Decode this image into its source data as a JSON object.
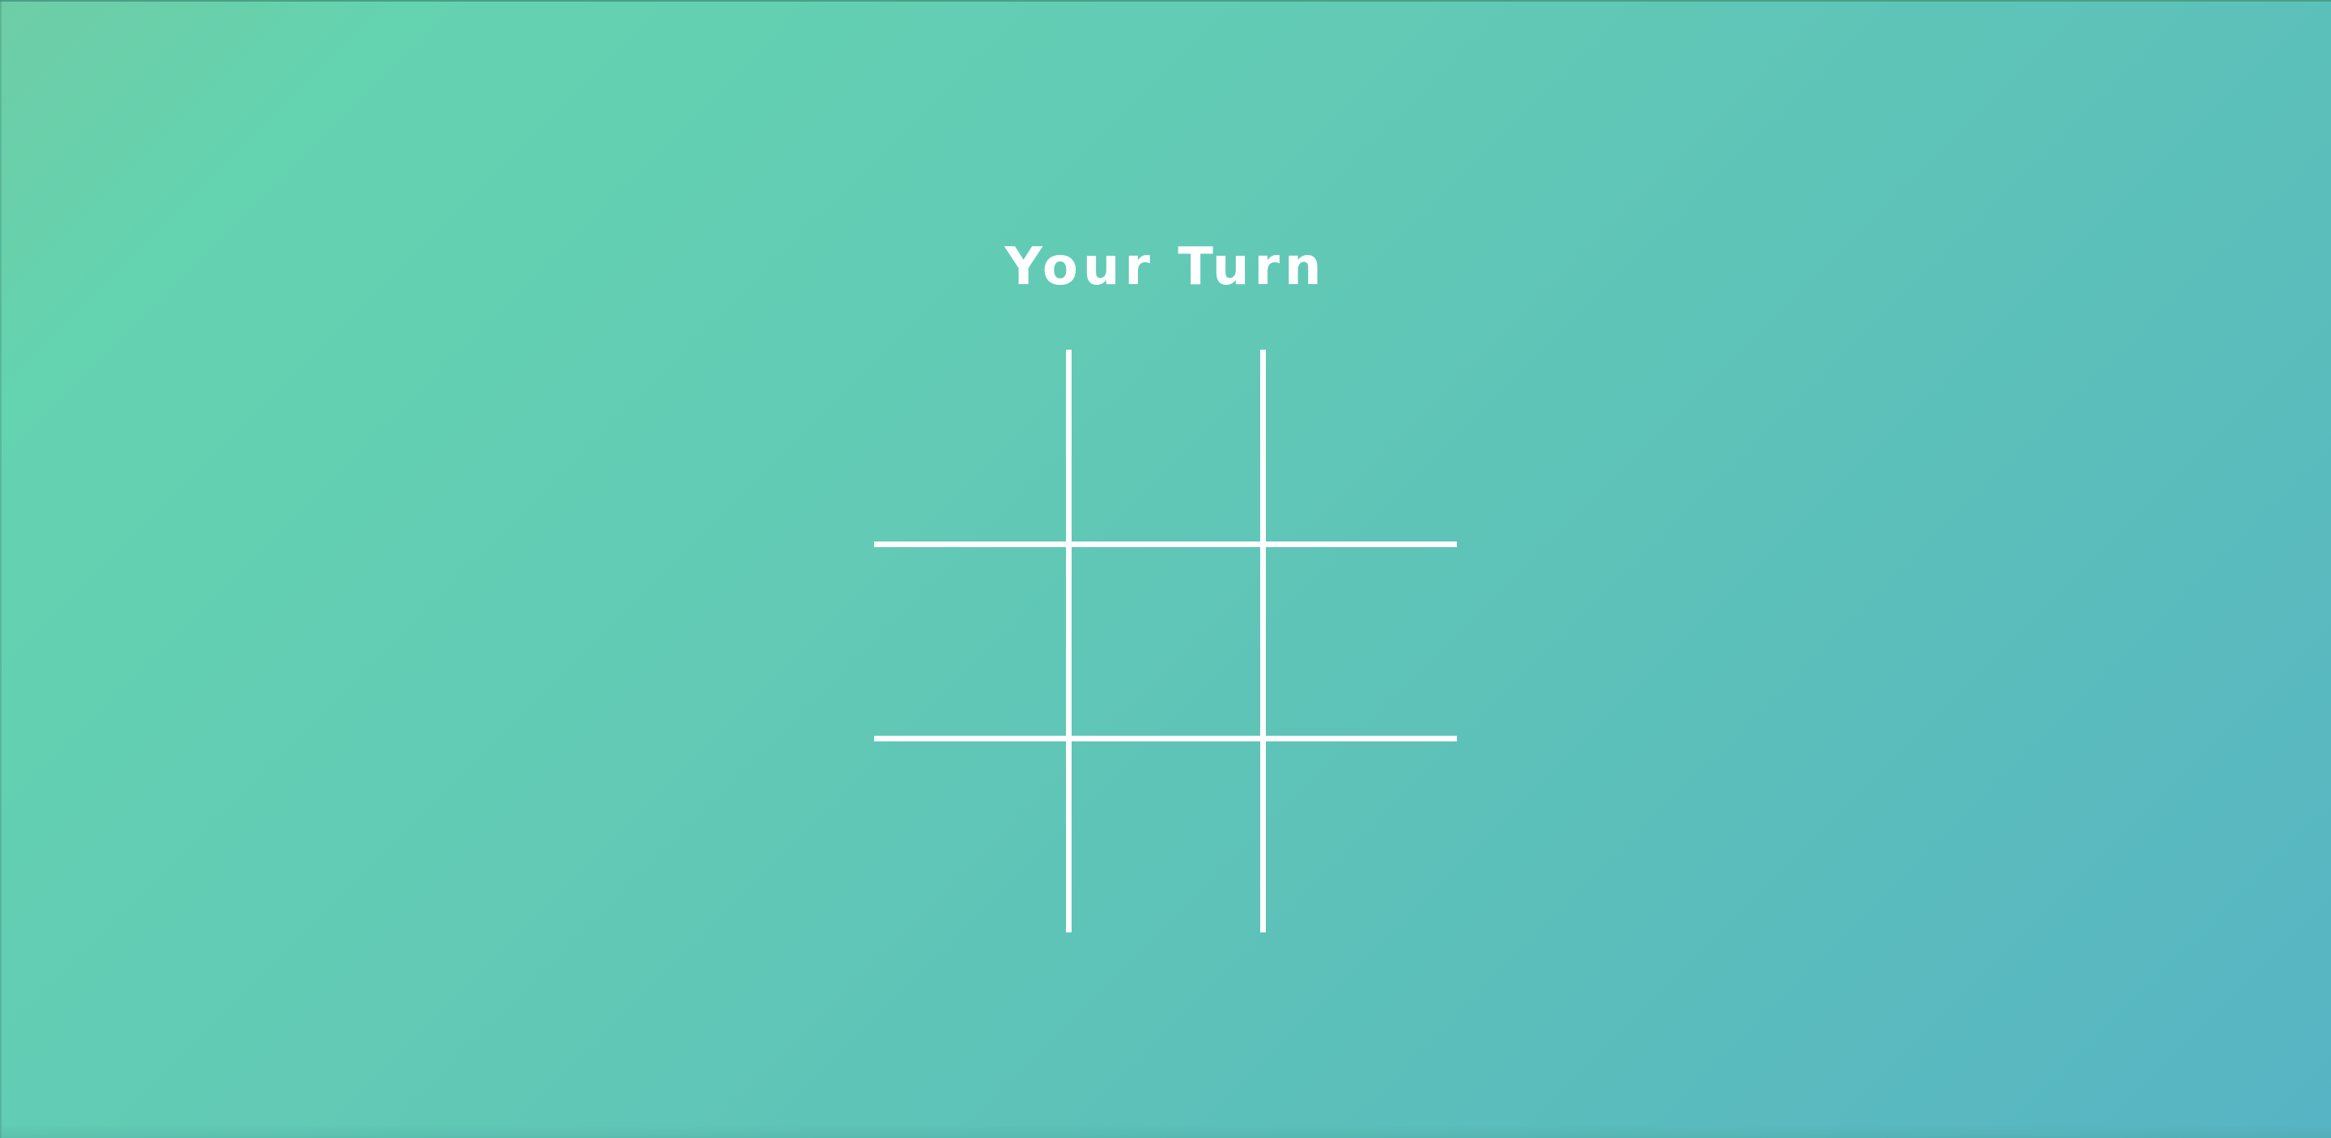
{
  "game": {
    "status_text": "Your Turn",
    "board": {
      "rows": 3,
      "cols": 3,
      "cells": [
        "",
        "",
        "",
        "",
        "",
        "",
        "",
        "",
        ""
      ]
    }
  },
  "colors": {
    "background_start": "#6ecda6",
    "background_end": "#57b4c4",
    "grid_line": "#ffffff",
    "text": "#ffffff"
  }
}
